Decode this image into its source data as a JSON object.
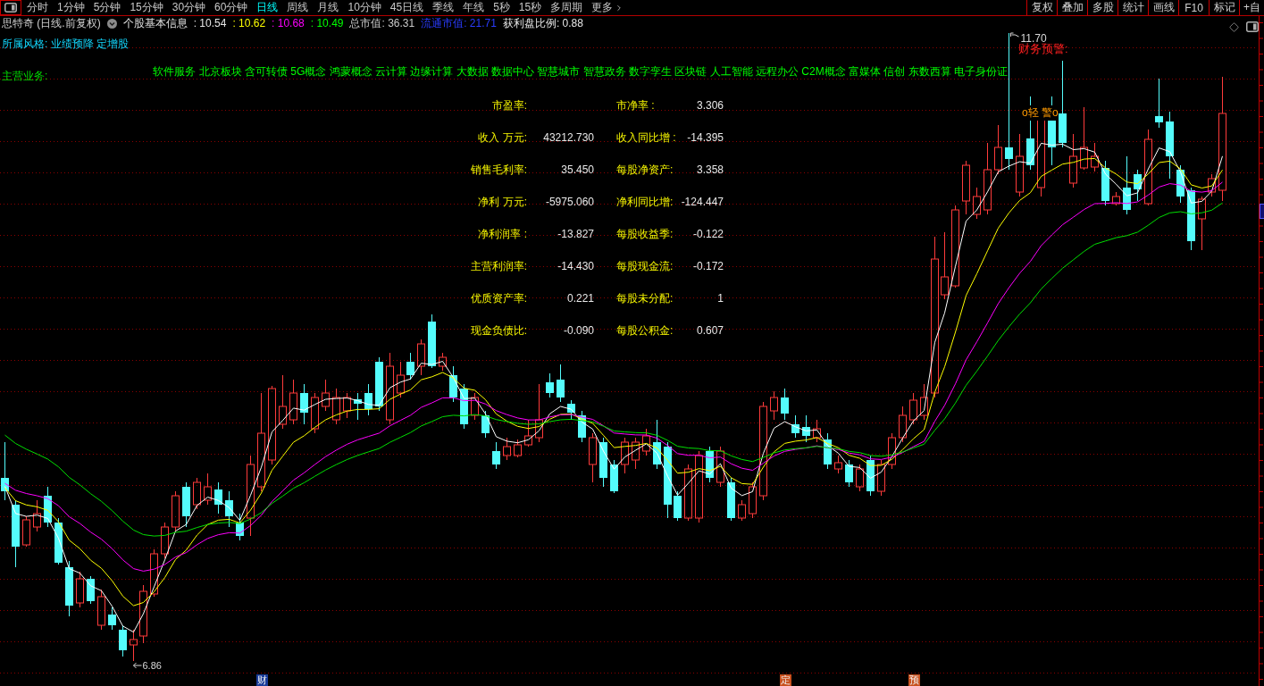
{
  "toolbar": {
    "periods": [
      {
        "label": "分时",
        "selected": false
      },
      {
        "label": "1分钟",
        "selected": false
      },
      {
        "label": "5分钟",
        "selected": false
      },
      {
        "label": "15分钟",
        "selected": false
      },
      {
        "label": "30分钟",
        "selected": false
      },
      {
        "label": "60分钟",
        "selected": false
      },
      {
        "label": "日线",
        "selected": true
      },
      {
        "label": "周线",
        "selected": false
      },
      {
        "label": "月线",
        "selected": false
      },
      {
        "label": "10分钟",
        "selected": false
      },
      {
        "label": "45日线",
        "selected": false
      },
      {
        "label": "季线",
        "selected": false
      },
      {
        "label": "年线",
        "selected": false
      },
      {
        "label": "5秒",
        "selected": false
      },
      {
        "label": "15秒",
        "selected": false
      },
      {
        "label": "多周期",
        "selected": false
      }
    ],
    "more": "更多",
    "actions": [
      "复权",
      "叠加",
      "多股",
      "统计",
      "画线",
      "F10",
      "标记",
      "+自"
    ]
  },
  "quote_bar": {
    "title": "思特奇 (日线.前复权)",
    "section": "个股基本信息",
    "values": [
      {
        "text": ": 10.54",
        "color": "#e6e6e6"
      },
      {
        "text": ": 10.62",
        "color": "#ffff00"
      },
      {
        "text": ": 10.68",
        "color": "#ff00ff"
      },
      {
        "text": ": 10.49",
        "color": "#00ff00"
      },
      {
        "text": "总市值: 36.31",
        "color": "#c8c8c8"
      },
      {
        "text": "流通市值: 21.71",
        "color": "#2a3cff"
      },
      {
        "text": "获利盘比例: 0.88",
        "color": "#e6e6e6"
      }
    ]
  },
  "style_line": "所属风格: 业绩预降 定增股",
  "business": {
    "label": "主营业务:",
    "concepts": "软件服务 北京板块 含可转债 5G概念 鸿蒙概念 云计算 边缘计算 大数据 数据中心 智慧城市 智慧政务 数字孪生 区块链 人工智能 远程办公 C2M概念 富媒体 信创 东数西算 电子身份证"
  },
  "fundamentals": [
    {
      "cells": [
        {
          "label": "市盈率:"
        },
        {
          "label": "市净率 :",
          "value": "3.306"
        }
      ]
    },
    {
      "cells": [
        {
          "label": "收入 万元:",
          "value": "43212.730"
        },
        {
          "label": "收入同比增 :",
          "value": "-14.395"
        }
      ]
    },
    {
      "cells": [
        {
          "label": "销售毛利率:",
          "value": "35.450"
        },
        {
          "label": "每股净资产:",
          "value": "3.358"
        }
      ]
    },
    {
      "cells": [
        {
          "label": "净利 万元:",
          "value": "-5975.060"
        },
        {
          "label": "净利同比增:",
          "value": "-124.447"
        }
      ]
    },
    {
      "cells": [
        {
          "label": "净利润率 :",
          "value": "-13.827"
        },
        {
          "label": "每股收益季:",
          "value": "-0.122"
        }
      ]
    },
    {
      "cells": [
        {
          "label": "主营利润率:",
          "value": "-14.430"
        },
        {
          "label": "每股现金流:",
          "value": "-0.172"
        }
      ]
    },
    {
      "cells": [
        {
          "label": "优质资产率:",
          "value": "0.221"
        },
        {
          "label": "每股未分配:",
          "value": "1"
        }
      ]
    },
    {
      "cells": [
        {
          "label": "现金负债比:",
          "value": "-0.090"
        },
        {
          "label": "每股公积金:",
          "value": "0.607"
        }
      ]
    }
  ],
  "chart": {
    "alert_title": "财务预警:",
    "alert_note": "o轻 警o",
    "price_marks": [
      {
        "kind": "high",
        "text": "11.70"
      },
      {
        "kind": "low",
        "text": "6.86"
      }
    ],
    "event_tags": [
      {
        "text": "财",
        "color": "#1a3c9a"
      },
      {
        "text": "定",
        "color": "#c8501e"
      },
      {
        "text": "预",
        "color": "#c8501e"
      }
    ]
  }
}
